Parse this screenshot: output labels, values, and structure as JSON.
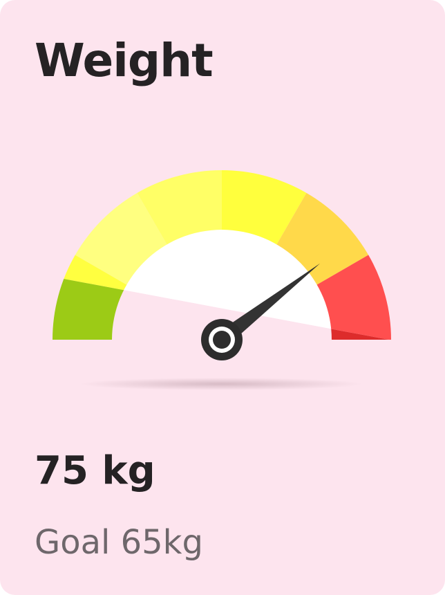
{
  "card": {
    "title": "Weight",
    "value": "75 kg",
    "goal": "Goal 65kg"
  },
  "gauge": {
    "reading": 75,
    "goal": 65,
    "pointer_position": 0.79,
    "segments": [
      {
        "color": "#ffff40",
        "shade": "#9ccb16"
      },
      {
        "color": "#ffff80",
        "shade": "#fcf36e"
      },
      {
        "color": "#ffff66",
        "shade": "#ffff66"
      },
      {
        "color": "#ffff3d",
        "shade": "#ffff3d"
      },
      {
        "color": "#ffd94a",
        "shade": "#ffd94a"
      },
      {
        "color": "#ff4f4f",
        "shade": "#dd2c2c"
      }
    ],
    "needle_color": "#333333",
    "hub_color": "#2d2d2d"
  }
}
